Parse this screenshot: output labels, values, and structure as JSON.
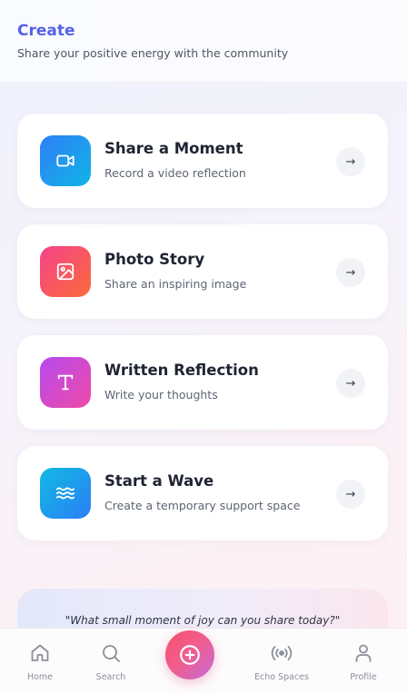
{
  "header": {
    "title": "Create",
    "subtitle": "Share your positive energy with the community"
  },
  "cards": [
    {
      "title": "Share a Moment",
      "subtitle": "Record a video reflection",
      "icon": "video-camera-icon",
      "gradient": [
        "#2f7ff6",
        "#10b4e6"
      ]
    },
    {
      "title": "Photo Story",
      "subtitle": "Share an inspiring image",
      "icon": "image-icon",
      "gradient": [
        "#f5438a",
        "#fb6a3a"
      ]
    },
    {
      "title": "Written Reflection",
      "subtitle": "Write your thoughts",
      "icon": "text-icon",
      "gradient": [
        "#b64af0",
        "#ef4aa6"
      ]
    },
    {
      "title": "Start a Wave",
      "subtitle": "Create a temporary support space",
      "icon": "waves-icon",
      "gradient": [
        "#11b9e3",
        "#2b7ff5"
      ]
    }
  ],
  "arrow_glyph": "→",
  "prompt": "\"What small moment of joy can you share today?\"",
  "nav": {
    "items": [
      {
        "label": "Home",
        "icon": "home-icon"
      },
      {
        "label": "Search",
        "icon": "search-icon"
      },
      {
        "label": "Echo Spaces",
        "icon": "broadcast-icon"
      },
      {
        "label": "Profile",
        "icon": "user-icon"
      }
    ],
    "fab_icon": "plus-circle-icon"
  },
  "colors": {
    "accent": "#5561e8",
    "fab_gradient": [
      "#f4506b",
      "#c56ad8"
    ]
  }
}
